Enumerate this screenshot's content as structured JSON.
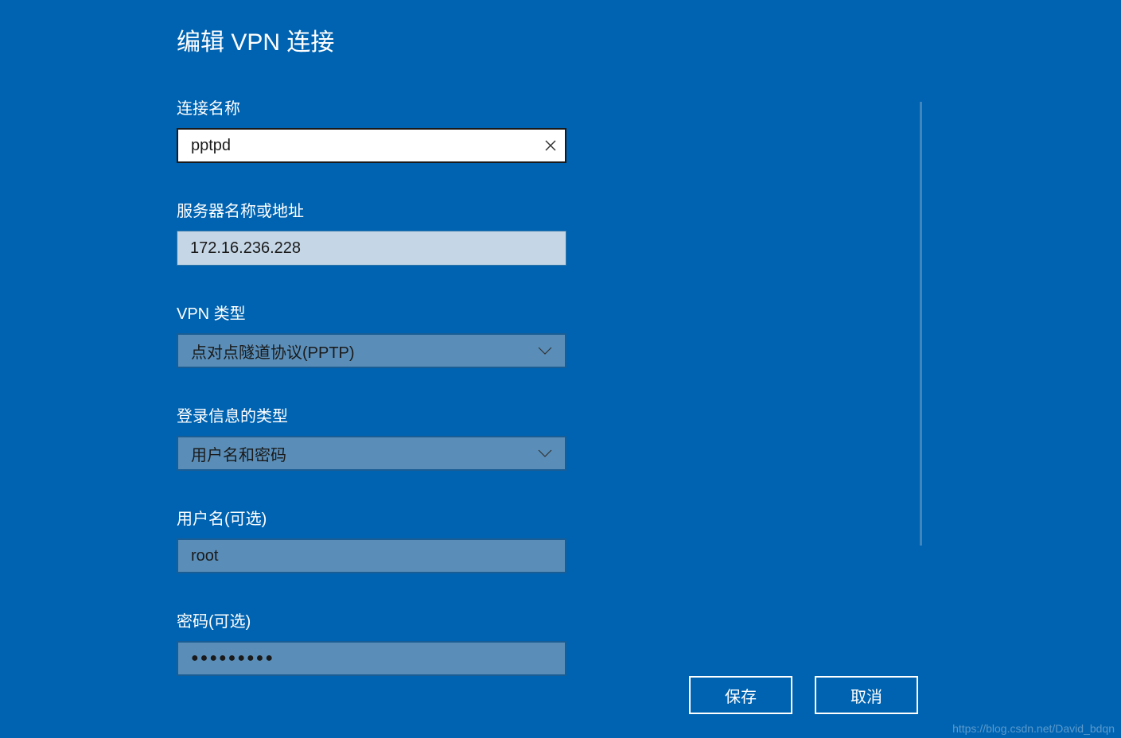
{
  "dialog": {
    "title": "编辑 VPN 连接"
  },
  "fields": {
    "connection_name": {
      "label": "连接名称",
      "value": "pptpd"
    },
    "server": {
      "label": "服务器名称或地址",
      "value": "172.16.236.228"
    },
    "vpn_type": {
      "label": "VPN 类型",
      "value": "点对点隧道协议(PPTP)"
    },
    "login_type": {
      "label": "登录信息的类型",
      "value": "用户名和密码"
    },
    "username": {
      "label": "用户名(可选)",
      "value": "root"
    },
    "password": {
      "label": "密码(可选)",
      "mask": "●●●●●●●●●"
    }
  },
  "buttons": {
    "save": "保存",
    "cancel": "取消"
  },
  "watermark": "https://blog.csdn.net/David_bdqn"
}
